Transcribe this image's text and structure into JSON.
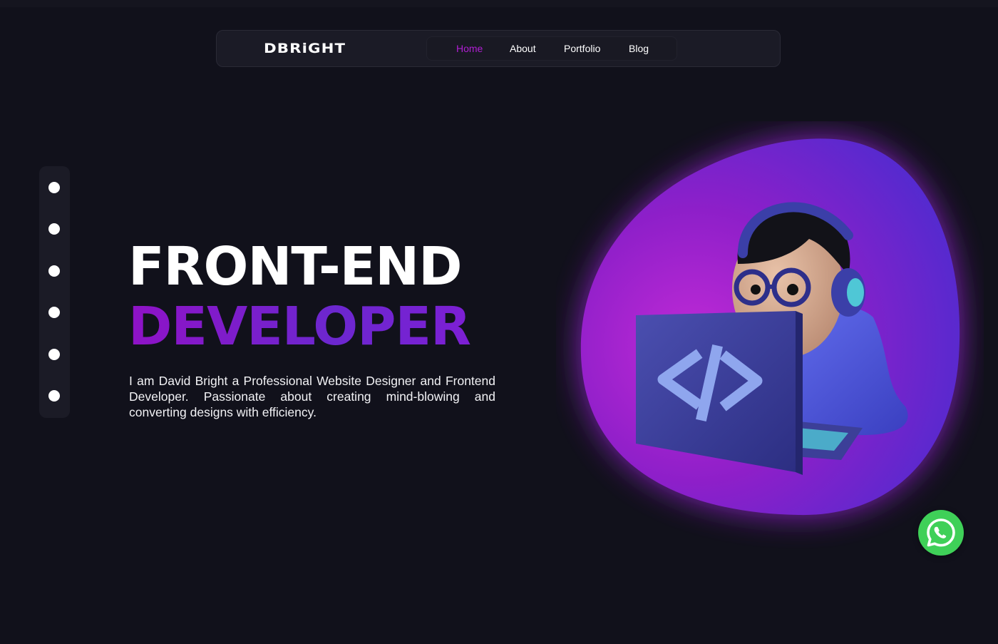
{
  "nav": {
    "logo": "DBRiGHT",
    "links": [
      "Home",
      "About",
      "Portfolio",
      "Blog"
    ],
    "active": "Home"
  },
  "side_dots_count": 6,
  "hero": {
    "line1": "FRONT-END",
    "line2": "DEVELOPER",
    "description": "I am David Bright a Professional Website Designer and Frontend Developer. Passionate about creating mind-blowing and converting designs with efficiency."
  },
  "illustration": {
    "icon": "developer-avatar-illustration",
    "code_symbol": "</>"
  },
  "whatsapp": {
    "icon": "whatsapp-icon"
  },
  "colors": {
    "background": "#11111b",
    "accent": "#b01ed3",
    "accent_gradient_end": "#6c27cf",
    "blob_purple": "#8e1fc9",
    "blob_blue": "#4a2cd0",
    "whatsapp_green": "#3fd058"
  }
}
